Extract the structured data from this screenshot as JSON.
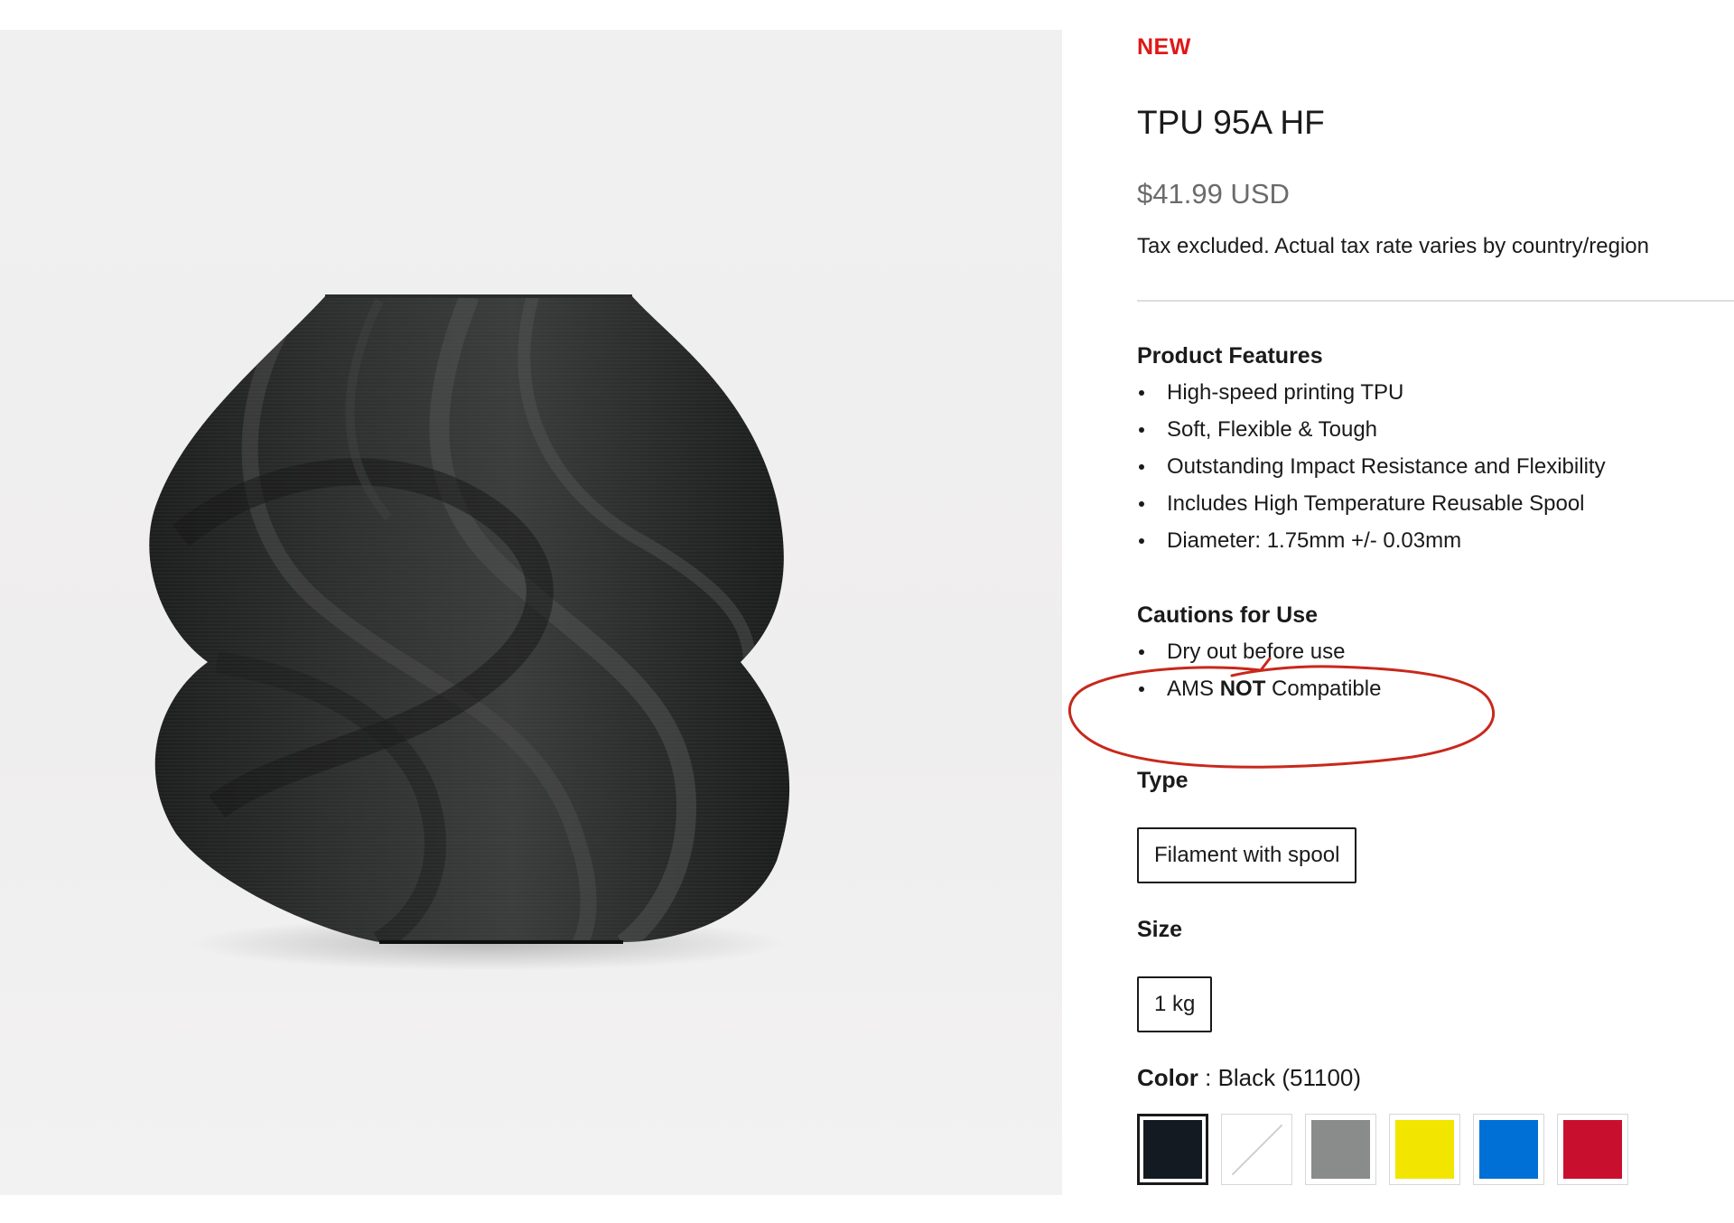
{
  "product": {
    "badge": "NEW",
    "title": "TPU 95A HF",
    "price": "$41.99 USD",
    "tax_note": "Tax excluded. Actual tax rate varies by country/region"
  },
  "features": {
    "title": "Product Features",
    "items": [
      "High-speed printing TPU",
      "Soft, Flexible & Tough",
      "Outstanding Impact Resistance and Flexibility",
      "Includes High Temperature Reusable Spool",
      "Diameter: 1.75mm +/- 0.03mm"
    ]
  },
  "cautions": {
    "title": "Cautions for Use",
    "item_1": "Dry out before use",
    "item_2_prefix": "AMS ",
    "item_2_bold": "NOT",
    "item_2_suffix": " Compatible"
  },
  "type": {
    "title": "Type",
    "selected": "Filament with spool"
  },
  "size": {
    "title": "Size",
    "selected": "1 kg"
  },
  "color": {
    "label": "Color",
    "separator": " : ",
    "value": "Black (51100)",
    "swatches": [
      {
        "name": "black",
        "hex": "#131a22",
        "selected": true
      },
      {
        "name": "white",
        "hex": "#ffffff",
        "selected": false
      },
      {
        "name": "gray",
        "hex": "#8a8c8c",
        "selected": false
      },
      {
        "name": "yellow",
        "hex": "#f2e500",
        "selected": false
      },
      {
        "name": "blue",
        "hex": "#006fd6",
        "selected": false
      },
      {
        "name": "red",
        "hex": "#c8102e",
        "selected": false
      }
    ]
  },
  "theme": {
    "accent": "#e01717",
    "annotation": "#c8281c"
  }
}
